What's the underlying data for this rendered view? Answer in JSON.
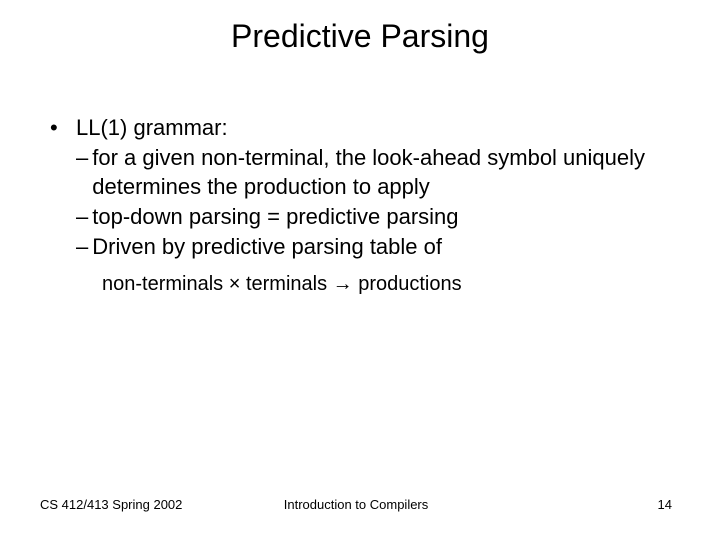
{
  "title": "Predictive Parsing",
  "bullet": {
    "label": "LL(1) grammar:",
    "subs": [
      "for a given non-terminal, the look-ahead symbol uniquely determines the production to apply",
      "top-down parsing = predictive parsing",
      "Driven by predictive parsing table of"
    ]
  },
  "formula": "non-terminals × terminals → productions",
  "footer": {
    "left": "CS 412/413   Spring 2002",
    "center": "Introduction to Compilers",
    "right": "14"
  }
}
